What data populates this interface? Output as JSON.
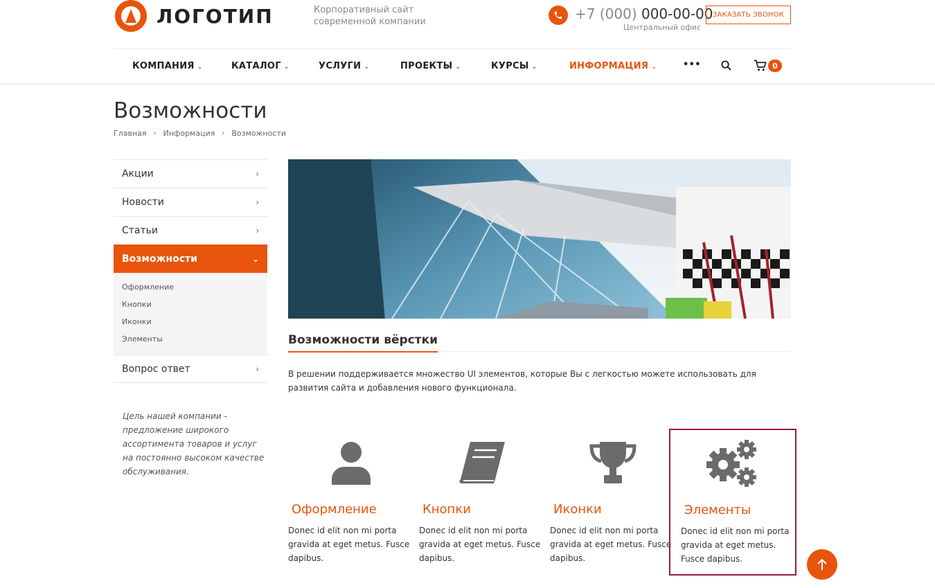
{
  "header": {
    "logo_text": "ЛОГОТИП",
    "slogan_line1": "Корпоративный сайт",
    "slogan_line2": "современной компании",
    "phone_code": "+7 (000)",
    "phone_number": "000-00-00",
    "office": "Центральный офис",
    "callback_label": "ЗАКАЗАТЬ ЗВОНОК",
    "cart_count": "0"
  },
  "nav": {
    "items": [
      {
        "label": "КОМПАНИЯ"
      },
      {
        "label": "КАТАЛОГ"
      },
      {
        "label": "УСЛУГИ"
      },
      {
        "label": "ПРОЕКТЫ"
      },
      {
        "label": "КУРСЫ"
      },
      {
        "label": "ИНФОРМАЦИЯ"
      }
    ],
    "more_label": "•••"
  },
  "page": {
    "title": "Возможности",
    "breadcrumb": [
      "Главная",
      "Информация",
      "Возможности"
    ]
  },
  "sidebar": {
    "items": [
      {
        "label": "Акции"
      },
      {
        "label": "Новости"
      },
      {
        "label": "Статьи"
      },
      {
        "label": "Возможности"
      },
      {
        "label": "Вопрос ответ"
      }
    ],
    "sub_items": [
      "Оформление",
      "Кнопки",
      "Иконки",
      "Элементы"
    ],
    "mission": "Цель нашей компании - предложение широкого ассортимента товаров и услуг на постоянно высоком качестве обслуживания."
  },
  "main": {
    "heading": "Возможности вёрстки",
    "lead": "В решении поддерживается множество UI элементов, которые Вы с легкостью можете использовать для развития сайта и добавления нового функционала.",
    "features": [
      {
        "title": "Оформление",
        "text": "Donec id elit non mi porta gravida at eget metus. Fusce dapibus.",
        "icon": "user-icon"
      },
      {
        "title": "Кнопки",
        "text": "Donec id elit non mi porta gravida at eget metus. Fusce dapibus.",
        "icon": "book-icon"
      },
      {
        "title": "Иконки",
        "text": "Donec id elit non mi porta gravida at eget metus. Fusce dapibus.",
        "icon": "trophy-icon"
      },
      {
        "title": "Элементы",
        "text": "Donec id elit non mi porta gravida at eget metus. Fusce dapibus.",
        "icon": "gears-icon"
      }
    ]
  },
  "colors": {
    "accent": "#e8540c",
    "selection": "#9b1b3e",
    "icon": "#6b6b6b"
  }
}
